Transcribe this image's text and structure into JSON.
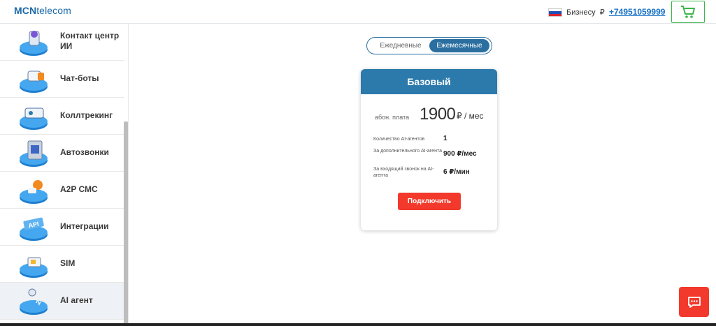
{
  "header": {
    "logo_bold": "MCN",
    "logo_rest": "telecom",
    "segment": "Бизнесу",
    "currency": "₽",
    "phone": "+74951059999"
  },
  "sidebar": {
    "items": [
      {
        "label": "Контакт центр ИИ",
        "icon": "ai-contact-center-icon"
      },
      {
        "label": "Чат-боты",
        "icon": "chatbot-icon"
      },
      {
        "label": "Коллтрекинг",
        "icon": "calltracking-icon"
      },
      {
        "label": "Автозвонки",
        "icon": "autocall-icon"
      },
      {
        "label": "A2P СМС",
        "icon": "sms-icon"
      },
      {
        "label": "Интеграции",
        "icon": "api-icon"
      },
      {
        "label": "SIM",
        "icon": "sim-icon"
      },
      {
        "label": "AI агент",
        "icon": "ai-agent-icon"
      }
    ],
    "active_index": 7
  },
  "toggle": {
    "daily": "Ежедневные",
    "monthly": "Ежемесячные",
    "selected": "monthly"
  },
  "card": {
    "title": "Базовый",
    "fee_label": "абон. плата",
    "fee_value": "1900",
    "fee_unit": "₽ / мес",
    "rows": [
      {
        "label": "Количество AI-агентов",
        "value": "1"
      },
      {
        "label": "За дополнительного AI-агента",
        "value": "900 ₽/мес"
      },
      {
        "label": "За входящий звонок на AI-агента",
        "value": "6 ₽/мин"
      }
    ],
    "button": "Подключить"
  },
  "colors": {
    "accent_blue": "#2b7aab",
    "cta_red": "#f2392b",
    "cart_green": "#3cb54a",
    "link_blue": "#1a73c7"
  }
}
